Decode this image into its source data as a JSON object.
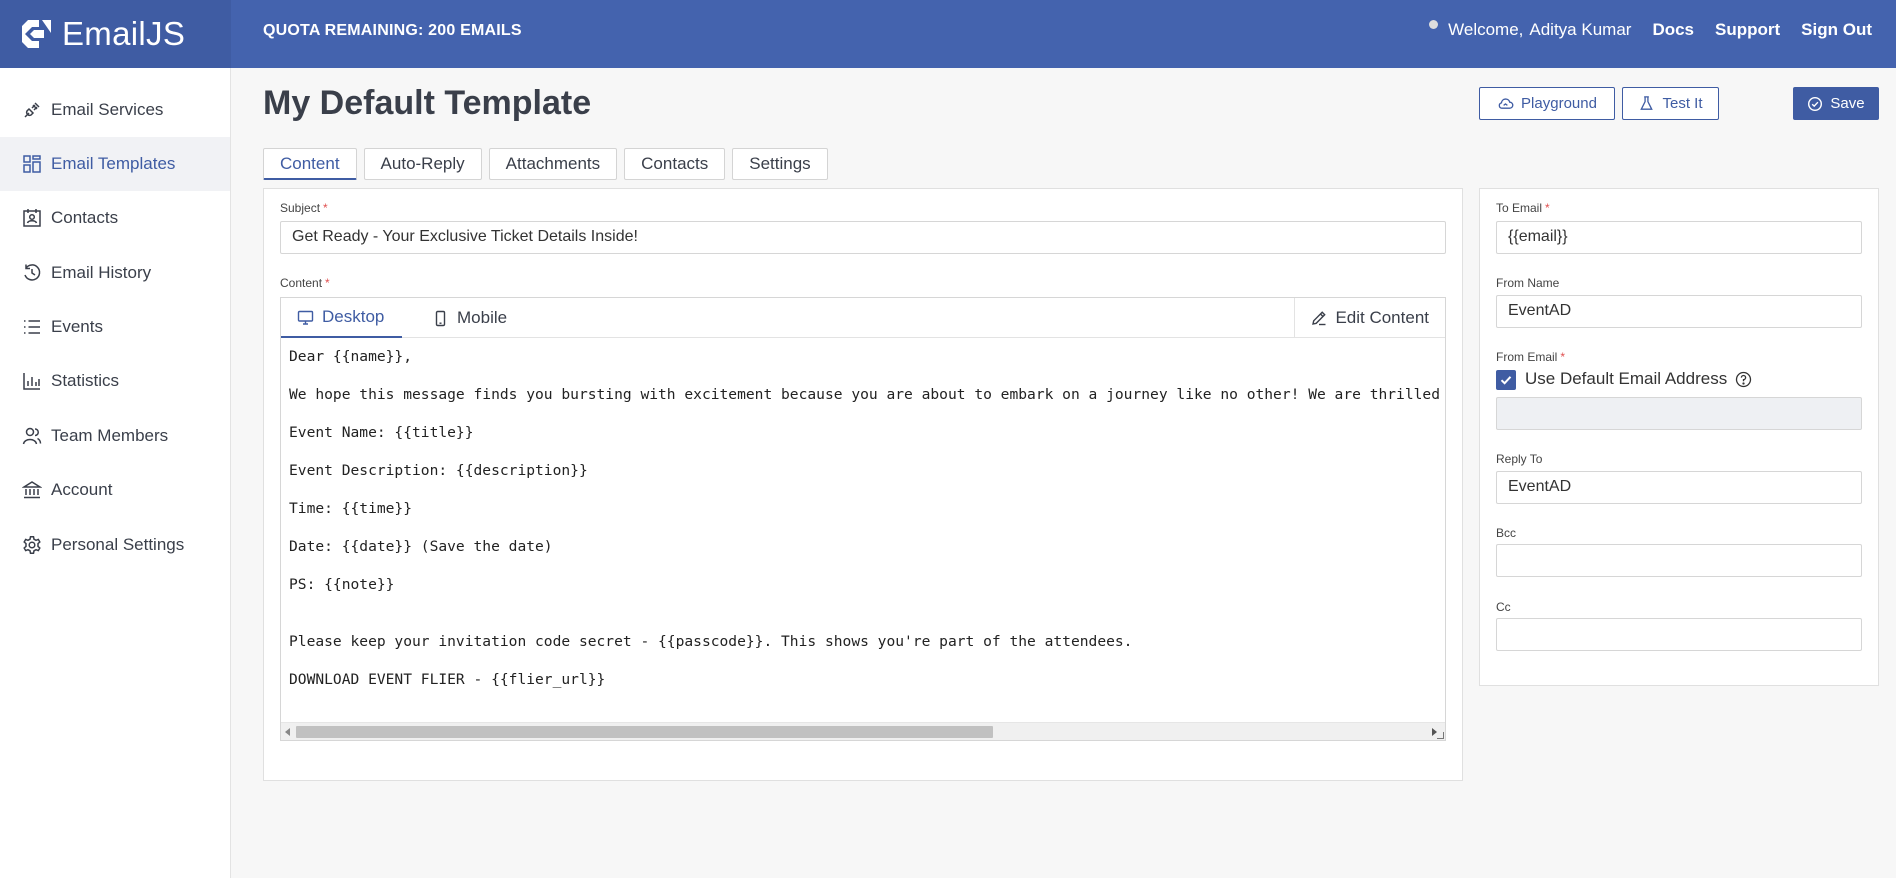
{
  "brand": {
    "name": "EmailJS"
  },
  "header": {
    "quota": "QUOTA REMAINING: 200 EMAILS",
    "welcome": "Welcome,",
    "user_name": "Aditya Kumar",
    "links": {
      "docs": "Docs",
      "support": "Support",
      "sign_out": "Sign Out"
    }
  },
  "sidebar": {
    "items": [
      {
        "label": "Email Services",
        "icon": "plug-icon"
      },
      {
        "label": "Email Templates",
        "icon": "templates-icon",
        "active": true
      },
      {
        "label": "Contacts",
        "icon": "contacts-icon"
      },
      {
        "label": "Email History",
        "icon": "history-icon"
      },
      {
        "label": "Events",
        "icon": "list-icon"
      },
      {
        "label": "Statistics",
        "icon": "chart-icon"
      },
      {
        "label": "Team Members",
        "icon": "users-icon"
      },
      {
        "label": "Account",
        "icon": "bank-icon"
      },
      {
        "label": "Personal Settings",
        "icon": "gear-icon"
      }
    ]
  },
  "page": {
    "title": "My Default Template",
    "buttons": {
      "playground": "Playground",
      "test_it": "Test It",
      "save": "Save"
    },
    "tabs": [
      "Content",
      "Auto-Reply",
      "Attachments",
      "Contacts",
      "Settings"
    ],
    "active_tab": "Content"
  },
  "form": {
    "subject_label": "Subject",
    "subject_value": "Get Ready - Your Exclusive Ticket Details Inside!",
    "content_label": "Content",
    "required_mark": "*"
  },
  "editor": {
    "tabs": {
      "desktop": "Desktop",
      "mobile": "Mobile"
    },
    "edit_content": "Edit Content",
    "lines": [
      "Dear {{name}},",
      "We hope this message finds you bursting with excitement because you are about to embark on a journey like no other! We are thrilled",
      "Event Name: {{title}}",
      "Event Description: {{description}}",
      "Time: {{time}}",
      "Date: {{date}} (Save the date)",
      "PS: {{note}}",
      "Please keep your invitation code secret - {{passcode}}. This shows you're part of the attendees.",
      "DOWNLOAD EVENT FLIER - {{flier_url}}"
    ]
  },
  "settings": {
    "to_email_label": "To Email",
    "to_email_value": "{{email}}",
    "from_name_label": "From Name",
    "from_name_value": "EventAD",
    "from_email_label": "From Email",
    "use_default_label": "Use Default Email Address",
    "use_default_checked": true,
    "from_email_value": "",
    "reply_to_label": "Reply To",
    "reply_to_value": "EventAD",
    "bcc_label": "Bcc",
    "bcc_value": "",
    "cc_label": "Cc",
    "cc_value": ""
  },
  "colors": {
    "brand": "#4463ae",
    "brand_dark": "#3f5ca3",
    "required": "#e05050"
  }
}
